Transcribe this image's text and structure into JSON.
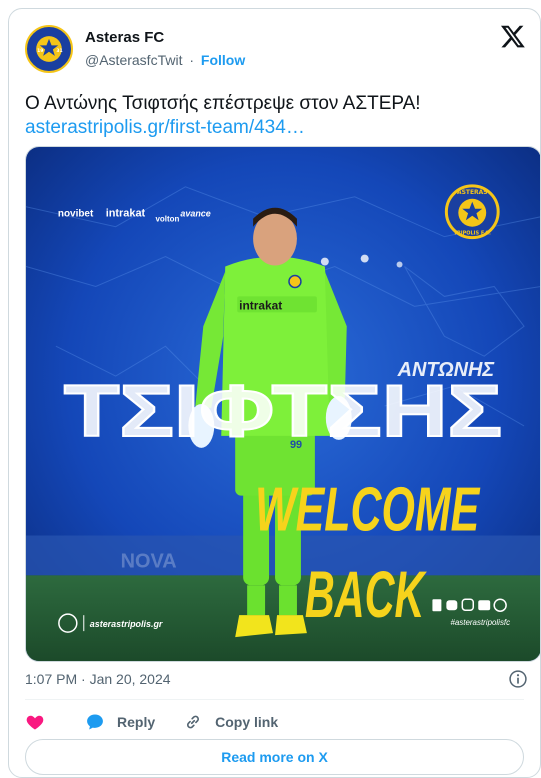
{
  "author": {
    "name": "Asteras FC",
    "handle": "@AsterasfcTwit",
    "separator": "·",
    "follow_label": "Follow"
  },
  "tweet": {
    "text": "Ο Αντώνης Τσιφτσής επέστρεψε στον ΑΣΤΕΡΑ!",
    "link": "asterastripolis.gr/first-team/434…",
    "timestamp": "1:07 PM · Jan 20, 2024"
  },
  "media": {
    "first_name": "ΑΝΤΩΝΗΣ",
    "last_name": "ΤΣΙΦΤΣΗΣ",
    "headline_1": "WELCOME",
    "headline_2": "BACK",
    "sponsor_1": "novibet",
    "sponsor_2": "intrakat",
    "sponsor_3": "volton",
    "sponsor_4": "avance",
    "shirt_sponsor": "intrakat",
    "shirt_number": "99",
    "website": "asterastripolis.gr",
    "social_handle": "#asterastripolisfc",
    "stadium_banner": "NOVA",
    "crest_text": "ASTERAS",
    "crest_subtext": "TRIPOLIS F.C.",
    "crest_year_left": "19",
    "crest_year_right": "31"
  },
  "actions": {
    "reply_label": "Reply",
    "copy_link_label": "Copy link",
    "read_more_label": "Read more on X"
  },
  "colors": {
    "link": "#1d9bf0",
    "muted": "#536471",
    "like": "#f91880",
    "reply": "#1d9bf0",
    "poster_blue": "#1447b8",
    "poster_yellow": "#f6d31c",
    "keeper_green": "#7ef03a"
  }
}
